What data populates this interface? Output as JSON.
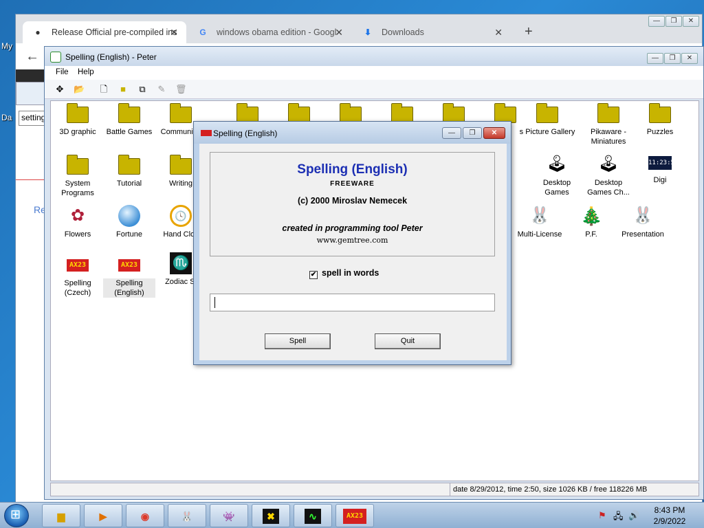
{
  "desktop": {
    "label_top": "My",
    "label_mid": "Da"
  },
  "chrome": {
    "tabs": [
      {
        "title": "Release Official pre-compiled ins",
        "icon": "github-icon"
      },
      {
        "title": "windows obama edition - Googl",
        "icon": "google-icon"
      },
      {
        "title": "Downloads",
        "icon": "download-icon"
      }
    ],
    "new_tab": "+",
    "close_glyph": "✕",
    "back_glyph": "←",
    "behind_input_value": "setting",
    "behind_link": "Re"
  },
  "peter": {
    "title": "Spelling (English) - Peter",
    "menu": {
      "file": "File",
      "help": "Help"
    },
    "icons": [
      {
        "label": "3D graphic",
        "kind": "folder"
      },
      {
        "label": "Battle Games",
        "kind": "folder"
      },
      {
        "label": "Communica",
        "kind": "folder"
      },
      {
        "label": "s Picture Gallery",
        "kind": "folder"
      },
      {
        "label": "Pikaware - Miniatures",
        "kind": "folder"
      },
      {
        "label": "Puzzles",
        "kind": "folder"
      },
      {
        "label": "System Programs",
        "kind": "folder"
      },
      {
        "label": "Tutorial",
        "kind": "folder"
      },
      {
        "label": "Writing",
        "kind": "folder"
      },
      {
        "label": "Desktop Games",
        "kind": "app"
      },
      {
        "label": "Desktop Games Ch...",
        "kind": "app"
      },
      {
        "label": "Digi",
        "kind": "digi",
        "display": "11:23:51"
      },
      {
        "label": "Flowers",
        "kind": "flower"
      },
      {
        "label": "Fortune",
        "kind": "ball"
      },
      {
        "label": "Hand Cloc",
        "kind": "clock"
      },
      {
        "label": "Multi-License",
        "kind": "bunny"
      },
      {
        "label": "P.F.",
        "kind": "tree"
      },
      {
        "label": "Presentation",
        "kind": "bunny"
      },
      {
        "label": "Spelling (Czech)",
        "kind": "ax23",
        "display": "AX23"
      },
      {
        "label": "Spelling (English)",
        "kind": "ax23",
        "display": "AX23"
      },
      {
        "label": "Zodiac Si",
        "kind": "zodiac"
      }
    ],
    "status": "date 8/29/2012, time 2:50, size 1026 KB / free 118226 MB"
  },
  "dialog": {
    "title": "Spelling (English)",
    "heading": "Spelling (English)",
    "license": "FREEWARE",
    "copyright": "(c) 2000 Miroslav Nemecek",
    "created_with": "created in programming tool Peter",
    "url": "www.gemtree.com",
    "checkbox_label": "spell in words",
    "checkbox_checked": true,
    "input_value": "",
    "spell_button": "Spell",
    "quit_button": "Quit"
  },
  "taskbar": {
    "time": "8:43 PM",
    "date": "2/9/2022",
    "items": [
      "explorer",
      "media-player",
      "chrome",
      "peter",
      "alien",
      "x-app",
      "oscilloscope",
      "ax23"
    ],
    "ax23_label": "AX23"
  }
}
